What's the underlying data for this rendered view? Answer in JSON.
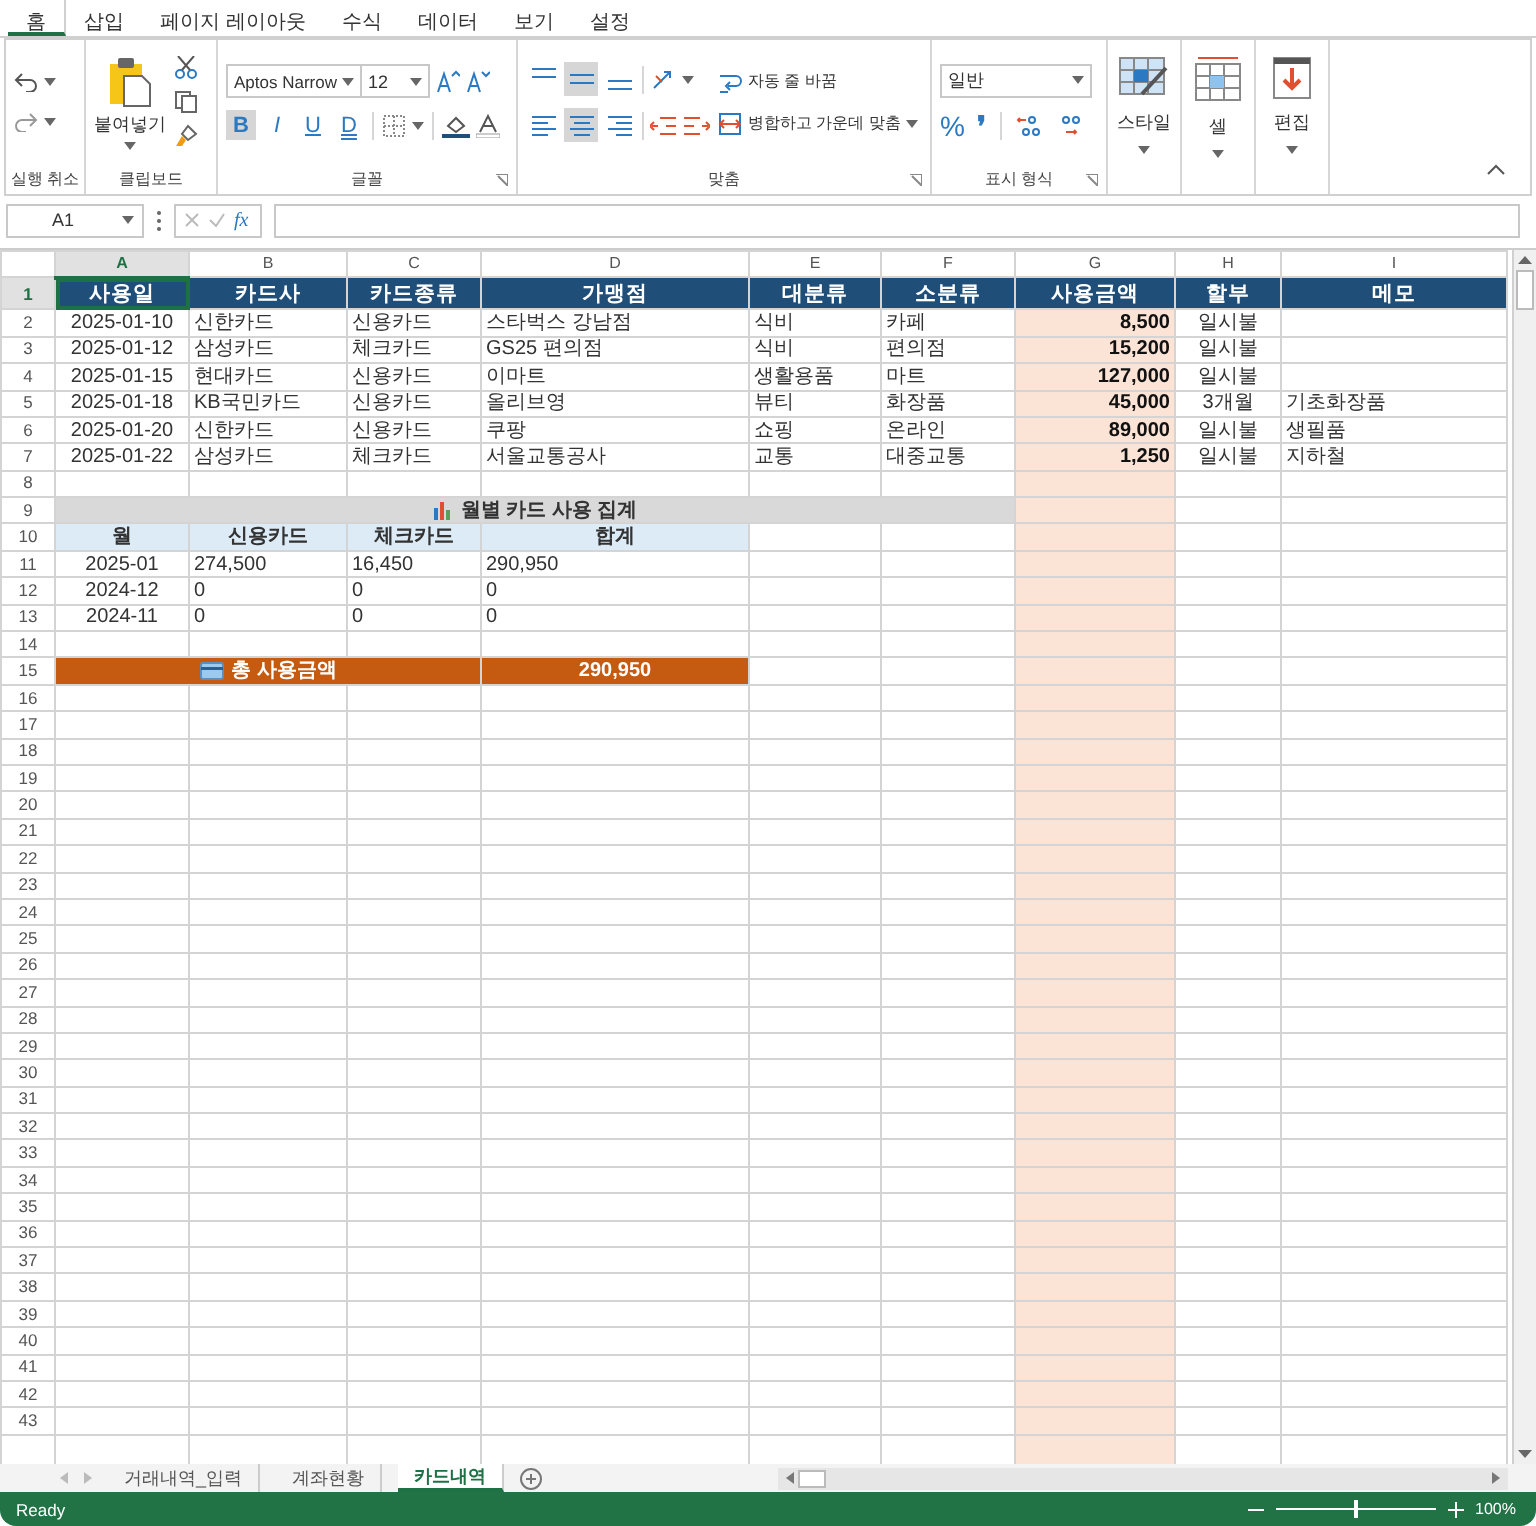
{
  "menu_tabs": [
    {
      "label": "홈",
      "selected": true
    },
    {
      "label": "삽입",
      "selected": false
    },
    {
      "label": "페이지 레이아웃",
      "selected": false
    },
    {
      "label": "수식",
      "selected": false
    },
    {
      "label": "데이터",
      "selected": false
    },
    {
      "label": "보기",
      "selected": false
    },
    {
      "label": "설정",
      "selected": false
    }
  ],
  "ribbon": {
    "undo": {
      "label": "실행 취소"
    },
    "clipboard": {
      "paste": "붙여넣기",
      "label": "클립보드"
    },
    "font": {
      "name": "Aptos Narrow",
      "size": "12",
      "label": "글꼴",
      "buttons": [
        {
          "kind": "bold",
          "text": "B",
          "pressed": true
        },
        {
          "kind": "italic",
          "text": "I",
          "pressed": false
        },
        {
          "kind": "underline",
          "text": "U",
          "pressed": false
        },
        {
          "kind": "double",
          "text": "D",
          "pressed": false
        }
      ]
    },
    "alignment": {
      "wrap": "자동 줄 바꿈",
      "merge": "병합하고 가운데 맞춤",
      "label": "맞춤",
      "vertical": [
        {
          "kind": "top",
          "pressed": false
        },
        {
          "kind": "middle",
          "pressed": true
        },
        {
          "kind": "bottom",
          "pressed": false
        }
      ],
      "horizontal": [
        {
          "kind": "left",
          "pressed": false
        },
        {
          "kind": "center",
          "pressed": true
        },
        {
          "kind": "right",
          "pressed": false
        }
      ]
    },
    "number": {
      "format": "일반",
      "percent": "%",
      "comma": "❜",
      "label": "표시 형식"
    },
    "styles": {
      "label": "스타일"
    },
    "cells": {
      "label": "셀"
    },
    "editing": {
      "label": "편집"
    }
  },
  "formula_bar": {
    "name_box": "A1",
    "fx": "fx"
  },
  "columns": [
    {
      "letter": "A",
      "selected": true,
      "highlight": false
    },
    {
      "letter": "B",
      "selected": false,
      "highlight": false
    },
    {
      "letter": "C",
      "selected": false,
      "highlight": false
    },
    {
      "letter": "D",
      "selected": false,
      "highlight": false
    },
    {
      "letter": "E",
      "selected": false,
      "highlight": false
    },
    {
      "letter": "F",
      "selected": false,
      "highlight": false
    },
    {
      "letter": "G",
      "selected": false,
      "highlight": true
    },
    {
      "letter": "H",
      "selected": false,
      "highlight": false
    },
    {
      "letter": "I",
      "selected": false,
      "highlight": false
    }
  ],
  "rows": [
    {
      "num": "1",
      "selected": true,
      "kind": "header",
      "cells": [
        "사용일",
        "카드사",
        "카드종류",
        "가맹점",
        "대분류",
        "소분류",
        "사용금액",
        "할부",
        "메모"
      ]
    },
    {
      "num": "2",
      "selected": false,
      "kind": "data",
      "cells": [
        "2025-01-10",
        "신한카드",
        "신용카드",
        "스타벅스 강남점",
        "식비",
        "카페",
        "8,500",
        "일시불"
      ]
    },
    {
      "num": "3",
      "selected": false,
      "kind": "data",
      "cells": [
        "2025-01-12",
        "삼성카드",
        "체크카드",
        "GS25 편의점",
        "식비",
        "편의점",
        "15,200",
        "일시불"
      ]
    },
    {
      "num": "4",
      "selected": false,
      "kind": "data",
      "cells": [
        "2025-01-15",
        "현대카드",
        "신용카드",
        "이마트",
        "생활용품",
        "마트",
        "127,000",
        "일시불"
      ]
    },
    {
      "num": "5",
      "selected": false,
      "kind": "data",
      "cells": [
        "2025-01-18",
        "KB국민카드",
        "신용카드",
        "올리브영",
        "뷰티",
        "화장품",
        "45,000",
        "3개월",
        "기초화장품"
      ]
    },
    {
      "num": "6",
      "selected": false,
      "kind": "data",
      "cells": [
        "2025-01-20",
        "신한카드",
        "신용카드",
        "쿠팡",
        "쇼핑",
        "온라인",
        "89,000",
        "일시불",
        "생필품"
      ]
    },
    {
      "num": "7",
      "selected": false,
      "kind": "data",
      "cells": [
        "2025-01-22",
        "삼성카드",
        "체크카드",
        "서울교통공사",
        "교통",
        "대중교통",
        "1,250",
        "일시불",
        "지하철"
      ]
    },
    {
      "num": "8",
      "selected": false,
      "kind": "blank"
    },
    {
      "num": "9",
      "selected": false,
      "kind": "section",
      "title": "월별 카드 사용 집계"
    },
    {
      "num": "10",
      "selected": false,
      "kind": "subheader",
      "cells": [
        "월",
        "신용카드",
        "체크카드",
        "합계"
      ]
    },
    {
      "num": "11",
      "selected": false,
      "kind": "summary",
      "cells": [
        "2025-01",
        "274,500",
        "16,450",
        "290,950"
      ]
    },
    {
      "num": "12",
      "selected": false,
      "kind": "summary",
      "cells": [
        "2024-12",
        "0",
        "0",
        "0"
      ]
    },
    {
      "num": "13",
      "selected": false,
      "kind": "summary",
      "cells": [
        "2024-11",
        "0",
        "0",
        "0"
      ]
    },
    {
      "num": "14",
      "selected": false,
      "kind": "blank"
    },
    {
      "num": "15",
      "selected": false,
      "kind": "total",
      "label": "총 사용금액",
      "value": "290,950"
    },
    {
      "num": "16",
      "selected": false,
      "kind": "blank"
    },
    {
      "num": "17",
      "selected": false,
      "kind": "blank"
    },
    {
      "num": "18",
      "selected": false,
      "kind": "blank"
    },
    {
      "num": "19",
      "selected": false,
      "kind": "blank"
    },
    {
      "num": "20",
      "selected": false,
      "kind": "blank"
    },
    {
      "num": "21",
      "selected": false,
      "kind": "blank"
    },
    {
      "num": "22",
      "selected": false,
      "kind": "blank"
    },
    {
      "num": "23",
      "selected": false,
      "kind": "blank"
    },
    {
      "num": "24",
      "selected": false,
      "kind": "blank"
    },
    {
      "num": "25",
      "selected": false,
      "kind": "blank"
    },
    {
      "num": "26",
      "selected": false,
      "kind": "blank"
    },
    {
      "num": "27",
      "selected": false,
      "kind": "blank"
    },
    {
      "num": "28",
      "selected": false,
      "kind": "blank"
    },
    {
      "num": "29",
      "selected": false,
      "kind": "blank"
    },
    {
      "num": "30",
      "selected": false,
      "kind": "blank"
    },
    {
      "num": "31",
      "selected": false,
      "kind": "blank"
    },
    {
      "num": "32",
      "selected": false,
      "kind": "blank"
    },
    {
      "num": "33",
      "selected": false,
      "kind": "blank"
    },
    {
      "num": "34",
      "selected": false,
      "kind": "blank"
    },
    {
      "num": "35",
      "selected": false,
      "kind": "blank"
    },
    {
      "num": "36",
      "selected": false,
      "kind": "blank"
    },
    {
      "num": "37",
      "selected": false,
      "kind": "blank"
    },
    {
      "num": "38",
      "selected": false,
      "kind": "blank"
    },
    {
      "num": "39",
      "selected": false,
      "kind": "blank"
    },
    {
      "num": "40",
      "selected": false,
      "kind": "blank"
    },
    {
      "num": "41",
      "selected": false,
      "kind": "blank"
    },
    {
      "num": "42",
      "selected": false,
      "kind": "blank"
    },
    {
      "num": "43",
      "selected": false,
      "kind": "blank"
    }
  ],
  "sheet_tabs": [
    {
      "label": "거래내역_입력",
      "selected": false
    },
    {
      "label": "계좌현황",
      "selected": false
    },
    {
      "label": "카드내역",
      "selected": true
    }
  ],
  "status_bar": {
    "status": "Ready",
    "zoom": "100%",
    "level": 0.5
  }
}
